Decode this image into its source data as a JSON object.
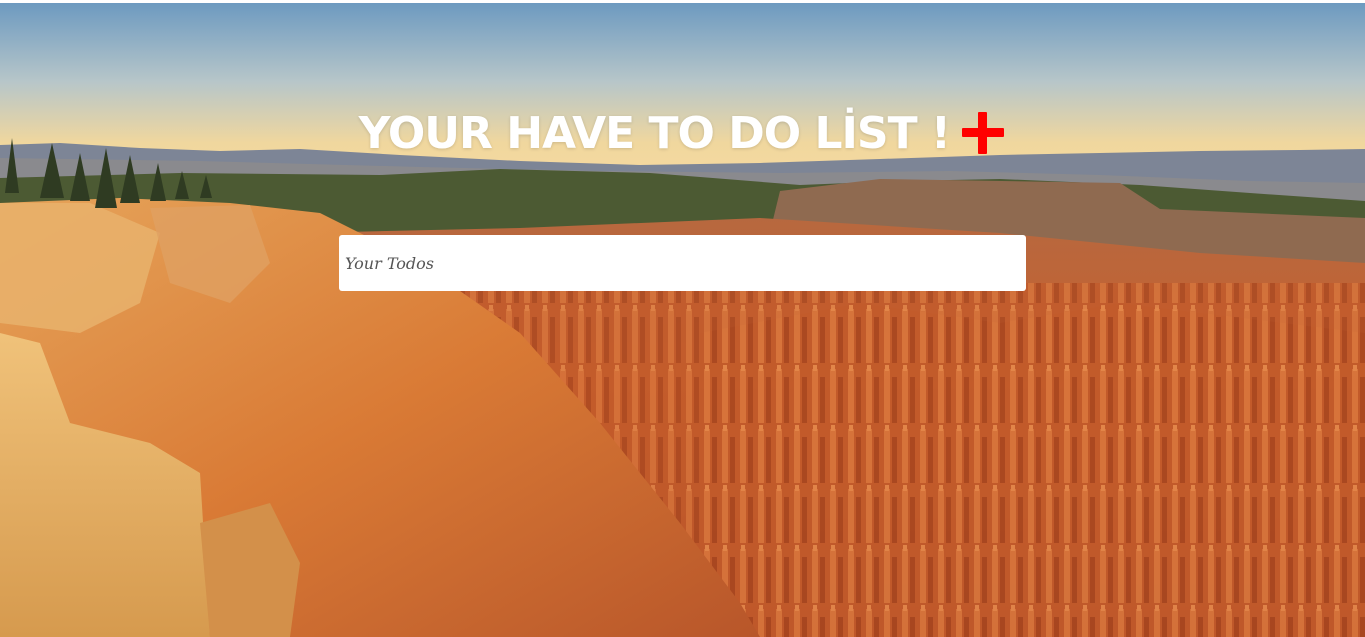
{
  "header": {
    "title": "YOUR HAVE TO DO LİST !",
    "add_icon": "plus-icon",
    "add_icon_color": "#ff0000"
  },
  "todo_input": {
    "placeholder": "Your Todos",
    "value": ""
  },
  "background": {
    "description_icon": "canyon-landscape-image",
    "sky_top": "#6f9bc0",
    "sky_bottom": "#f3d79a",
    "rock_color": "#c8612f"
  }
}
